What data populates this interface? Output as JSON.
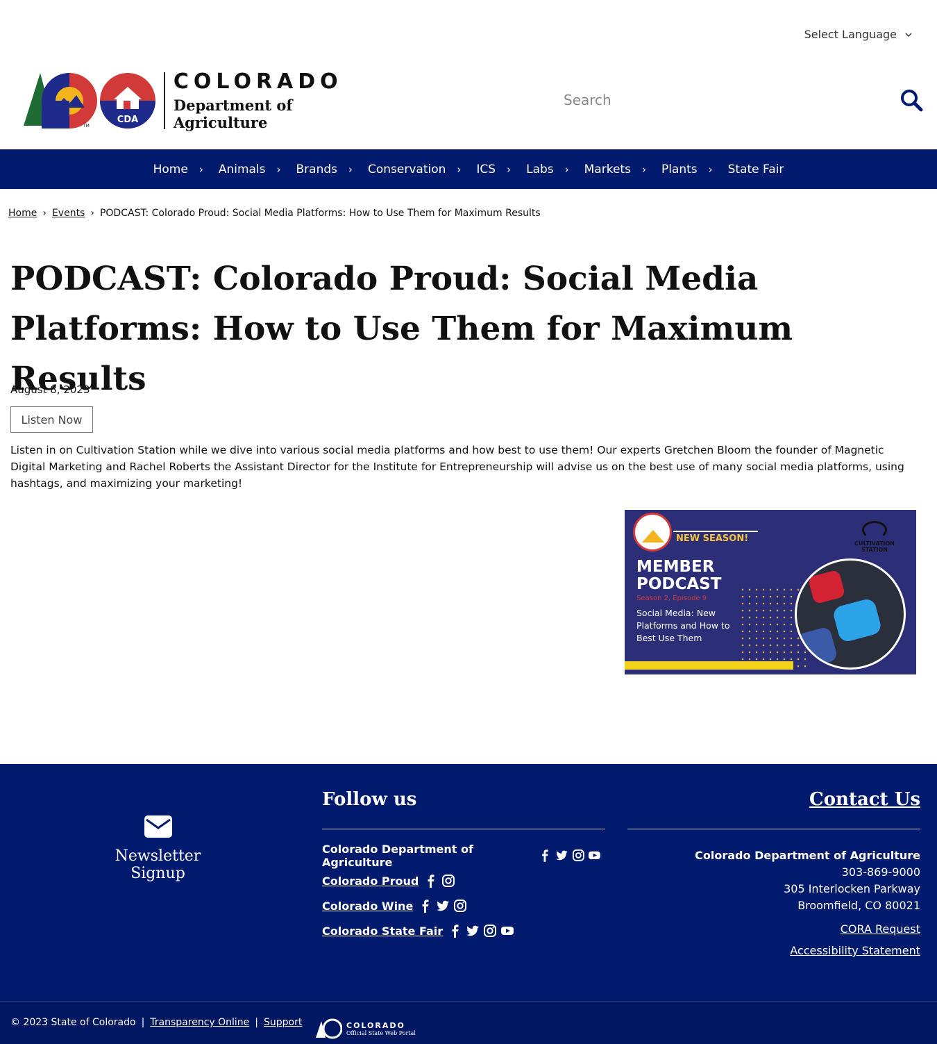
{
  "language": {
    "label": "Select Language"
  },
  "logo": {
    "wordmark": "COLORADO",
    "department": "Department of Agriculture",
    "seal_text": "CDA",
    "tm": "TM"
  },
  "search": {
    "placeholder": "Search"
  },
  "nav": {
    "items": [
      {
        "label": "Home"
      },
      {
        "label": "Animals"
      },
      {
        "label": "Brands"
      },
      {
        "label": "Conservation"
      },
      {
        "label": "ICS"
      },
      {
        "label": "Labs"
      },
      {
        "label": "Markets"
      },
      {
        "label": "Plants"
      },
      {
        "label": "State Fair"
      }
    ]
  },
  "breadcrumb": {
    "home": "Home",
    "events": "Events",
    "current": "PODCAST: Colorado Proud: Social Media Platforms: How to Use Them for Maximum Results"
  },
  "article": {
    "title": "PODCAST: Colorado Proud: Social Media Platforms: How to Use Them for Maximum Results",
    "date": "August 8, 2023",
    "listen_label": "Listen Now",
    "description": "Listen in on Cultivation Station while we dive into various social media platforms and how best to use them! Our experts Gretchen Bloom the founder of Magnetic Digital Marketing and Rachel Roberts the Assistant Director for the Institute for Entrepreneurship will advise us on the best use of many social media platforms, using hashtags, and maximizing your marketing!"
  },
  "promo": {
    "new_season": "NEW SEASON!",
    "member_podcast": "MEMBER PODCAST",
    "episode": "Season 2, Episode 9",
    "subtitle": "Social Media: New Platforms and How to Best Use Them",
    "brand": "CULTIVATION STATION"
  },
  "footer": {
    "newsletter": "Newsletter Signup",
    "follow_title": "Follow us",
    "social": [
      {
        "name": "Colorado Department of Agriculture",
        "icons": [
          "facebook-icon",
          "twitter-icon",
          "instagram-icon",
          "youtube-icon"
        ]
      },
      {
        "name": "Colorado Proud",
        "icons": [
          "facebook-icon",
          "instagram-icon"
        ]
      },
      {
        "name": "Colorado Wine",
        "icons": [
          "facebook-icon",
          "twitter-icon",
          "instagram-icon"
        ]
      },
      {
        "name": "Colorado State Fair",
        "icons": [
          "facebook-icon",
          "twitter-icon",
          "instagram-icon",
          "youtube-icon"
        ]
      }
    ],
    "contact_title": "Contact Us",
    "contact": {
      "org": "Colorado Department of Agriculture",
      "phone": "303-869-9000",
      "street": "305 Interlocken Parkway",
      "city": "Broomfield, CO 80021",
      "cora": "CORA Request",
      "accessibility": "Accessibility Statement"
    },
    "copyright": "© 2023 State of Colorado",
    "transparency": "Transparency Online",
    "support": "Support",
    "portal_name": "COLORADO",
    "portal_sub": "Official State Web Portal"
  },
  "colors": {
    "navy": "#021b6e",
    "red": "#d23a3a",
    "gold": "#f3b51b",
    "promo_bg": "#2c2f78"
  }
}
